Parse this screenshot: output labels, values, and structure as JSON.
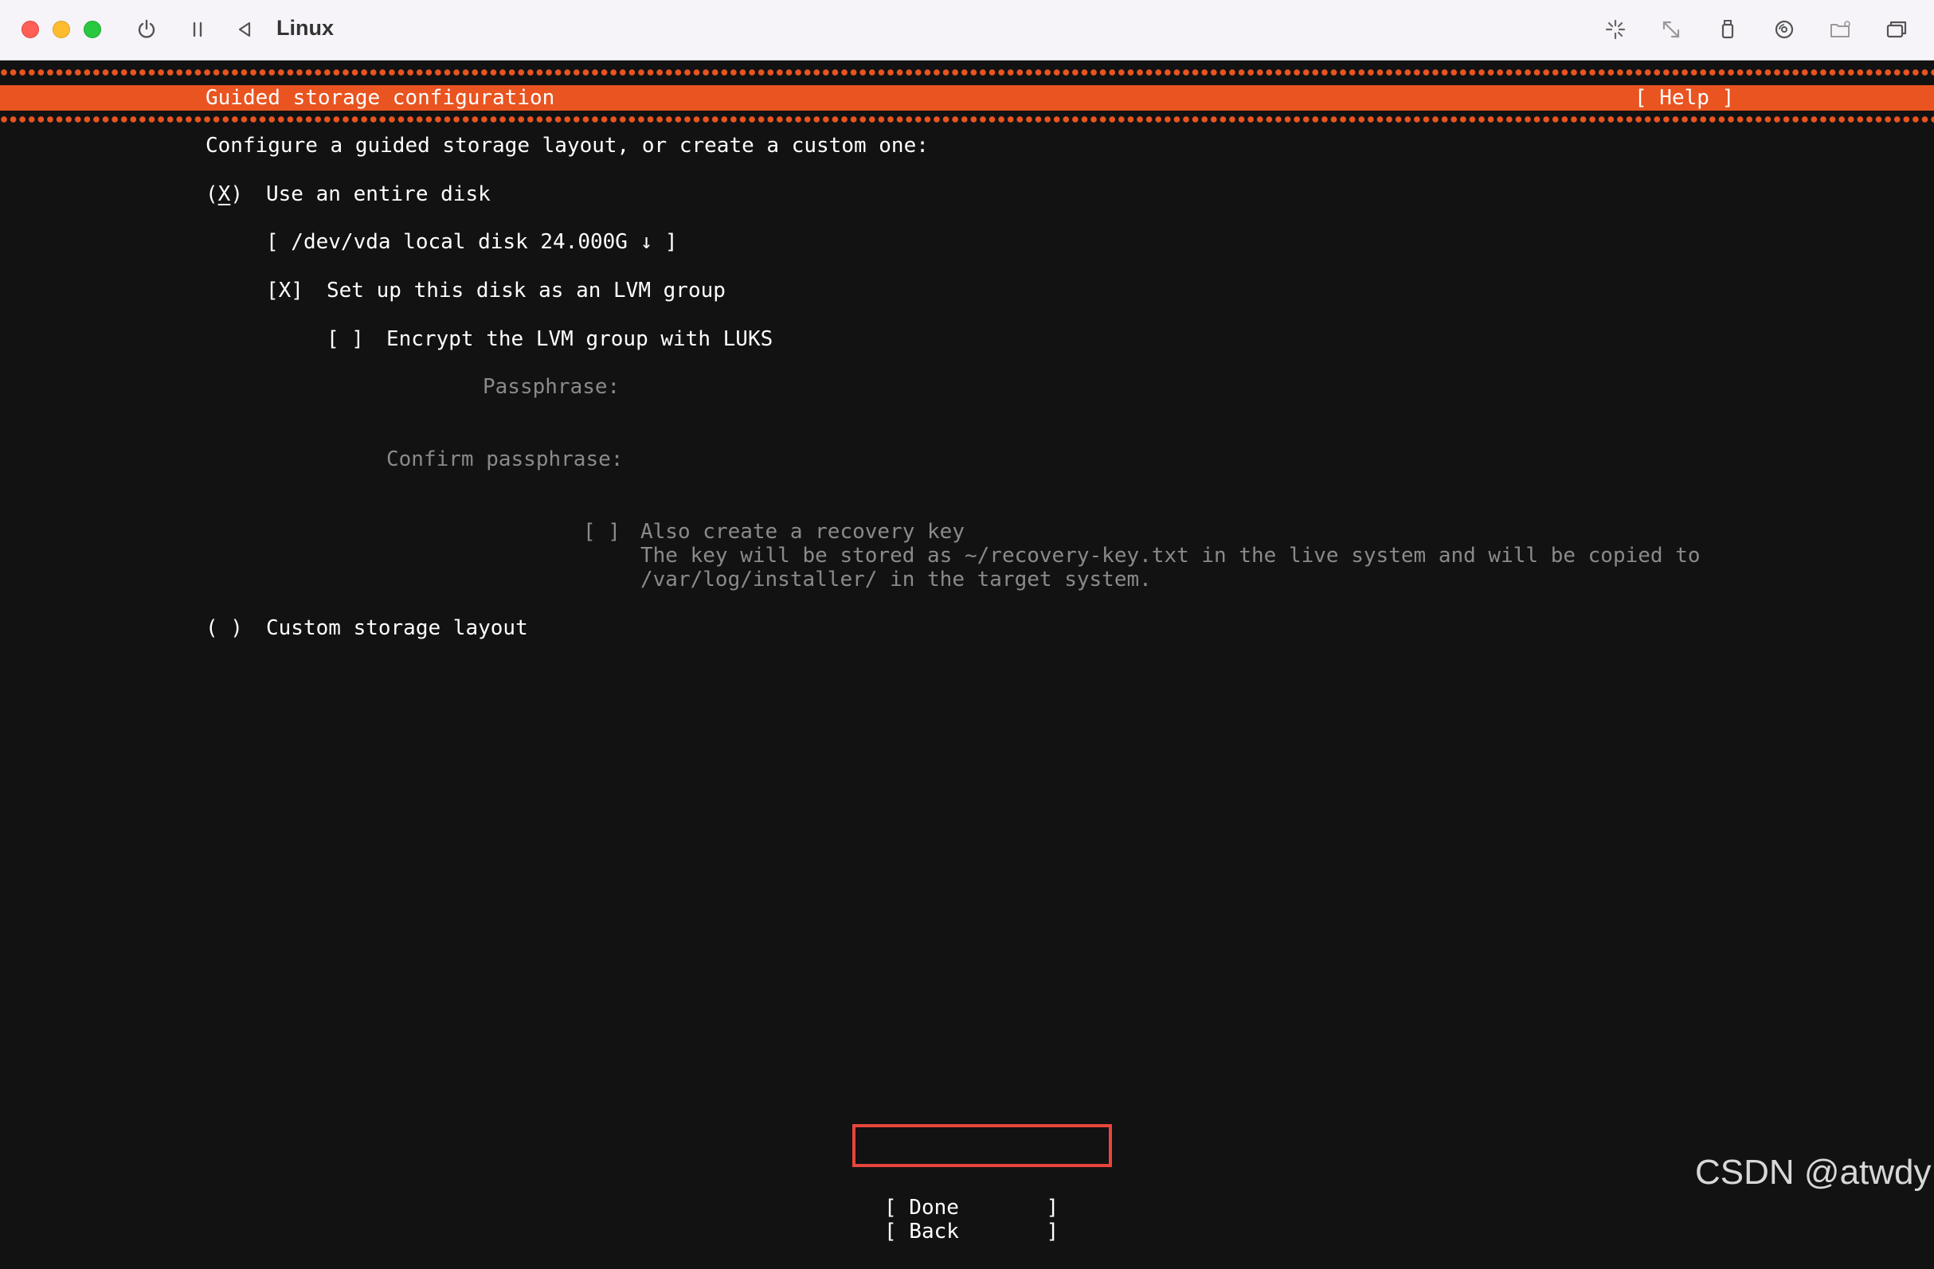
{
  "window": {
    "title": "Linux",
    "toolbar_icons": [
      "power-icon",
      "pause-icon",
      "back-icon",
      "brightness-icon",
      "resize-icon",
      "usb-icon",
      "disc-icon",
      "shared-folder-icon",
      "windows-icon"
    ]
  },
  "installer": {
    "header_title": "Guided storage configuration",
    "help_label": "[ Help ]",
    "intro": "Configure a guided storage layout, or create a custom one:",
    "entire_disk": {
      "marker_open": "(",
      "marker_mark": "X",
      "marker_close": ")",
      "label": "Use an entire disk",
      "selected": true
    },
    "disk_select": "[ /dev/vda local disk 24.000G ↓ ]",
    "lvm": {
      "marker": "[X]",
      "label": "Set up this disk as an LVM group",
      "checked": true
    },
    "luks": {
      "marker": "[ ]",
      "label": "Encrypt the LVM group with LUKS",
      "checked": false
    },
    "passphrase_label": "Passphrase:",
    "confirm_passphrase_label": "Confirm passphrase:",
    "recovery": {
      "marker": "[ ]",
      "label": "Also create a recovery key",
      "description_line1": "The key will be stored as ~/recovery-key.txt in the live system and will be copied to",
      "description_line2": "/var/log/installer/ in the target system."
    },
    "custom": {
      "marker": "( )",
      "label": "Custom storage layout",
      "selected": false
    },
    "done_label": "[ Done       ]",
    "back_label": "[ Back       ]"
  },
  "watermark": "CSDN @atwdy",
  "colors": {
    "accent": "#e95420",
    "background": "#121212",
    "highlight_box": "#e8453c"
  }
}
